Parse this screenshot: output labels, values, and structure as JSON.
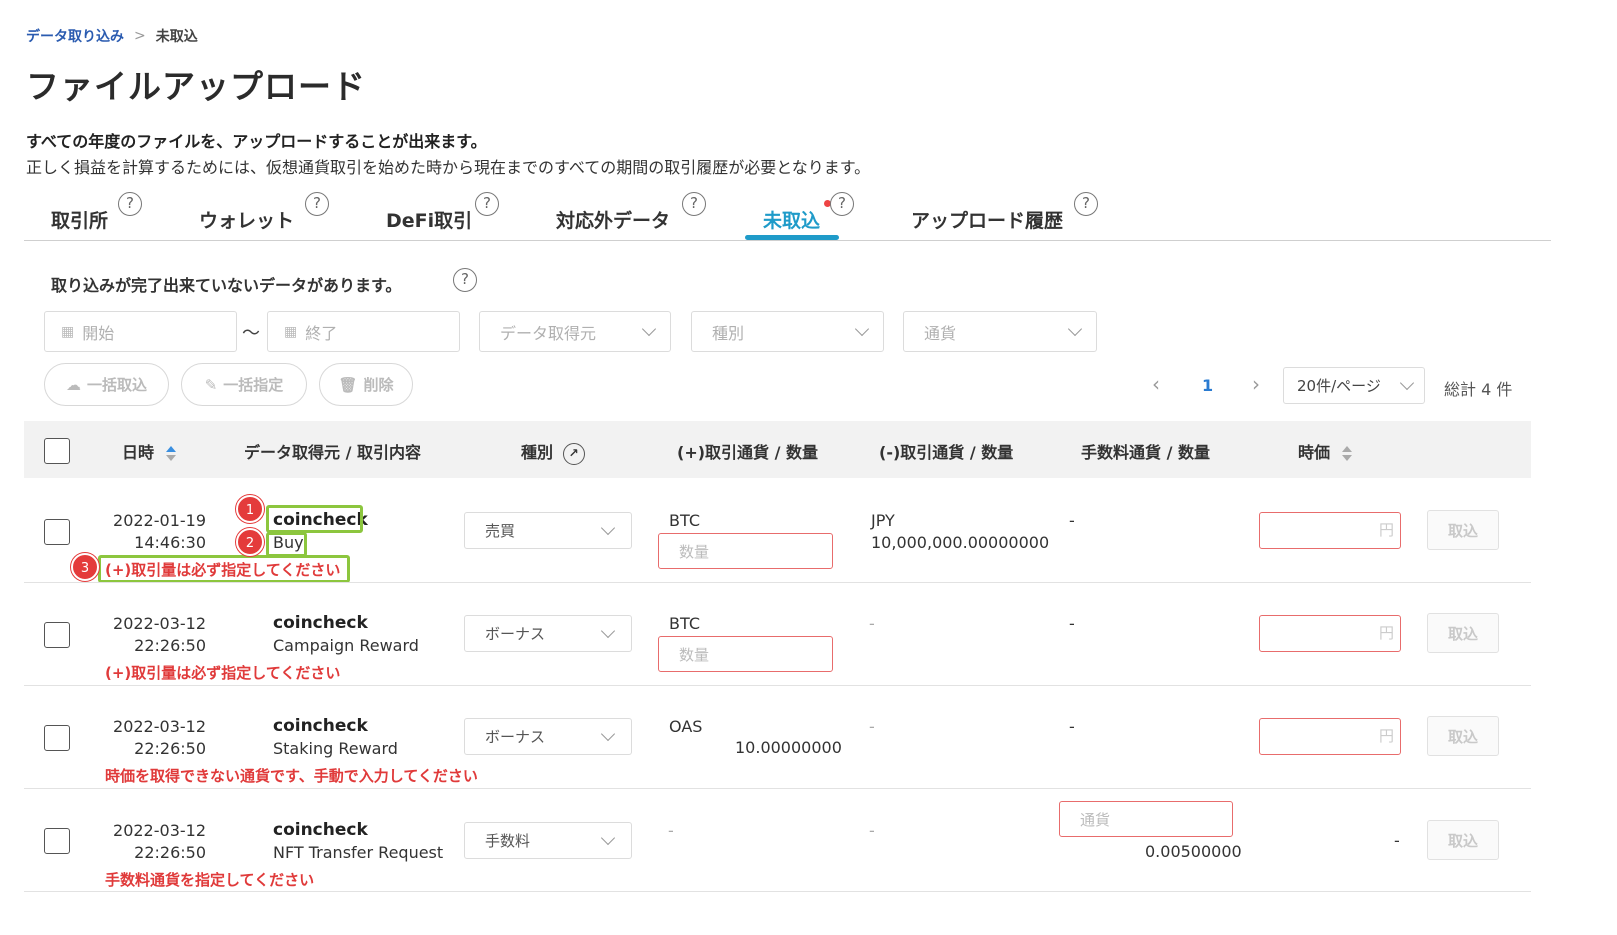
{
  "breadcrumb": {
    "parent": "データ取り込み",
    "separator": ">",
    "current": "未取込"
  },
  "page_title": "ファイルアップロード",
  "description": {
    "bold": "すべての年度のファイルを、アップロードすることが出来ます。",
    "normal": "正しく損益を計算するためには、仮想通貨取引を始めた時から現在までのすべての期間の取引履歴が必要となります。"
  },
  "tabs": [
    {
      "label": "取引所"
    },
    {
      "label": "ウォレット"
    },
    {
      "label": "DeFi取引"
    },
    {
      "label": "対応外データ"
    },
    {
      "label": "未取込"
    },
    {
      "label": "アップロード履歴"
    }
  ],
  "help_glyph": "?",
  "notice": "取り込みが完了出来ていないデータがあります。",
  "filters": {
    "start_placeholder": "開始",
    "range_sep": "〜",
    "end_placeholder": "終了",
    "source_placeholder": "データ取得元",
    "type_placeholder": "種別",
    "currency_placeholder": "通貨"
  },
  "actions": {
    "bulk_import": "一括取込",
    "bulk_assign": "一括指定",
    "delete": "削除"
  },
  "pagination": {
    "prev": "‹",
    "current_page": "1",
    "next": "›",
    "per_page": "20件/ページ",
    "total": "総計 4 件"
  },
  "table": {
    "headers": {
      "datetime": "日時",
      "source": "データ取得元 / 取引内容",
      "type": "種別",
      "plus": "(+)取引通貨 / 数量",
      "minus": "(-)取引通貨 / 数量",
      "fee": "手数料通貨 / 数量",
      "price": "時価"
    },
    "quantity_placeholder": "数量",
    "currency_placeholder": "通貨",
    "yen_suffix": "円",
    "import_label": "取込",
    "dash": "-",
    "rows": [
      {
        "date": "2022-01-19",
        "time": "14:46:30",
        "source": "coincheck",
        "detail": "Buy",
        "type": "売買",
        "plus_currency": "BTC",
        "plus_amount": "",
        "minus_currency": "JPY",
        "minus_amount": "10,000,000.00000000",
        "fee": "-",
        "fee_amount": "",
        "error": "(+)取引量は必ず指定してください"
      },
      {
        "date": "2022-03-12",
        "time": "22:26:50",
        "source": "coincheck",
        "detail": "Campaign Reward",
        "type": "ボーナス",
        "plus_currency": "BTC",
        "plus_amount": "",
        "minus_currency": "-",
        "minus_amount": "",
        "fee": "-",
        "fee_amount": "",
        "error": "(+)取引量は必ず指定してください"
      },
      {
        "date": "2022-03-12",
        "time": "22:26:50",
        "source": "coincheck",
        "detail": "Staking Reward",
        "type": "ボーナス",
        "plus_currency": "OAS",
        "plus_amount": "10.00000000",
        "minus_currency": "-",
        "minus_amount": "",
        "fee": "-",
        "fee_amount": "",
        "error": "時価を取得できない通貨です、手動で入力してください"
      },
      {
        "date": "2022-03-12",
        "time": "22:26:50",
        "source": "coincheck",
        "detail": "NFT Transfer Request",
        "type": "手数料",
        "plus_currency": "-",
        "plus_amount": "",
        "minus_currency": "-",
        "minus_amount": "",
        "fee": "",
        "fee_amount": "0.00500000",
        "price_text": "-",
        "error": "手数料通貨を指定してください"
      }
    ]
  },
  "markers": [
    "1",
    "2",
    "3"
  ],
  "colors": {
    "accent": "#1f9bc9",
    "error": "#e03a3a",
    "highlight": "#8cc63e",
    "marker": "#e43b3b"
  }
}
